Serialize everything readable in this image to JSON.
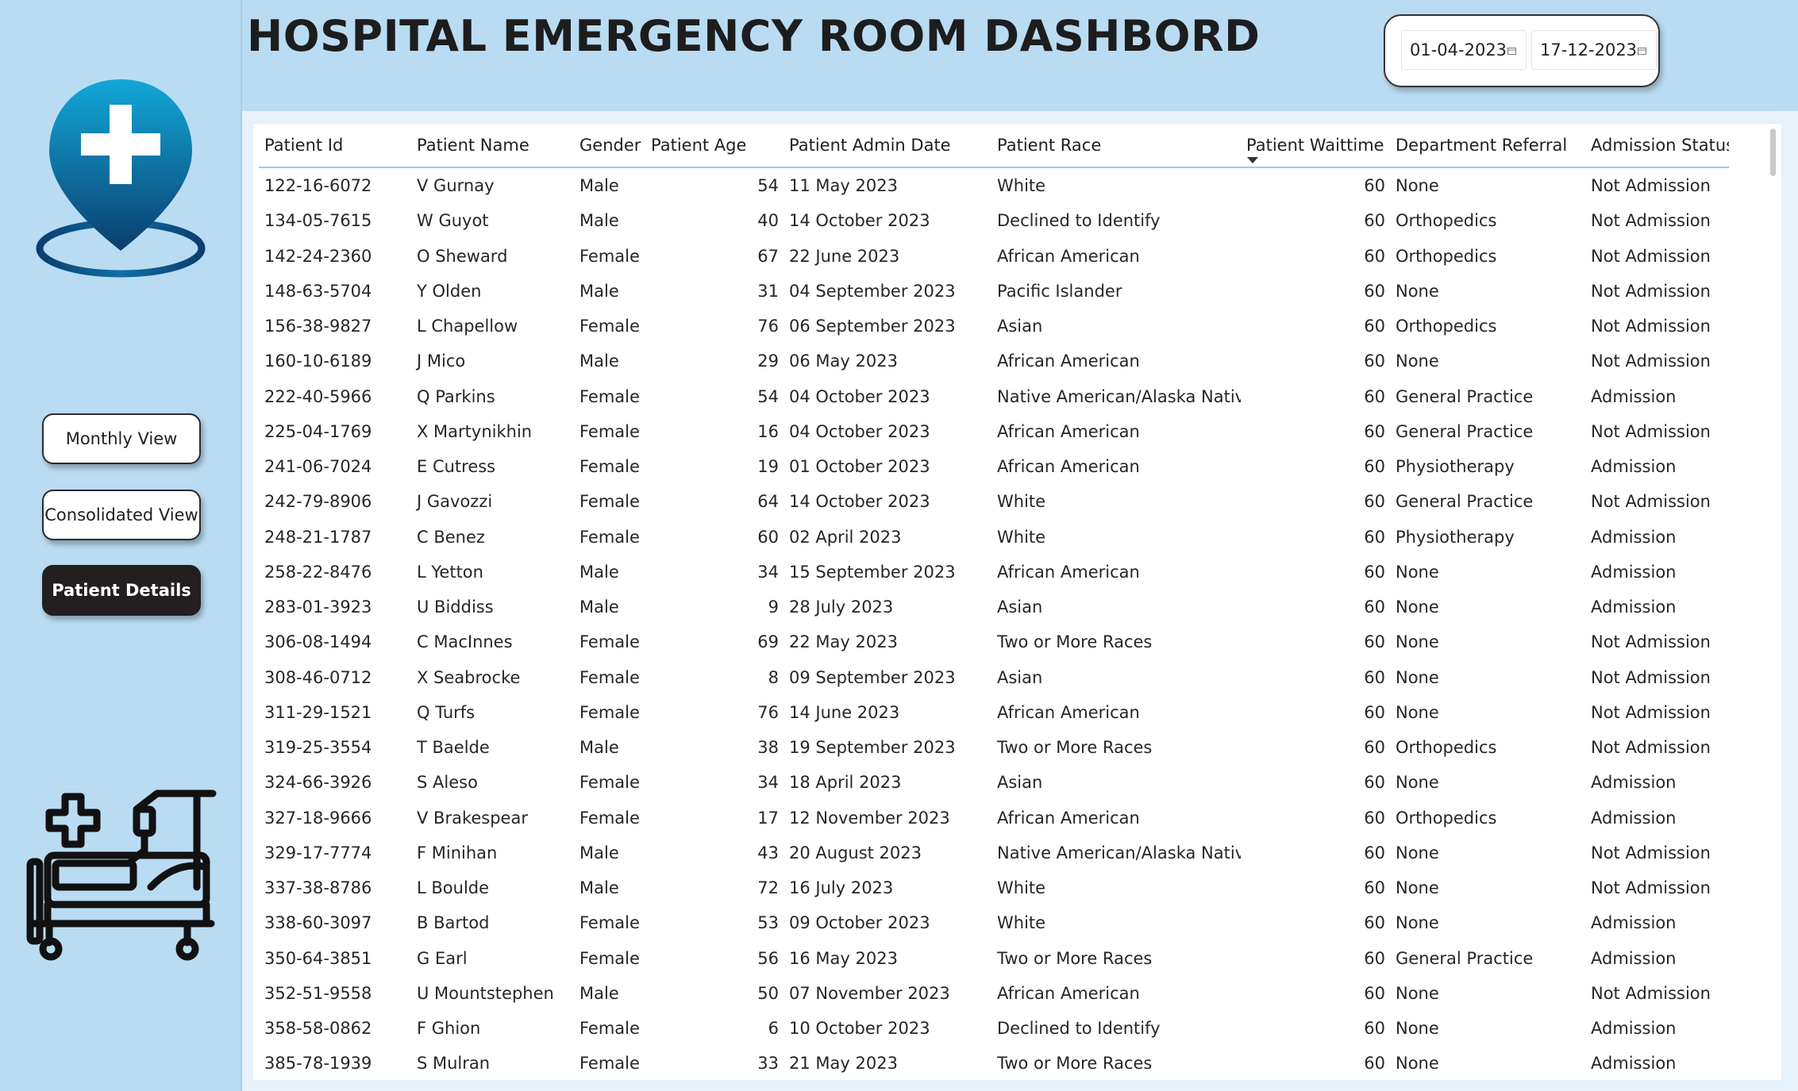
{
  "header": {
    "title": "HOSPITAL EMERGENCY ROOM DASHBORD",
    "date_start": "01-04-2023",
    "date_end": "17-12-2023"
  },
  "nav": {
    "monthly_label": "Monthly View",
    "consolidated_label": "Consolidated View",
    "patient_label": "Patient Details",
    "active": "Patient Details"
  },
  "colors": {
    "background": "#b9dcf3",
    "active_button": "#231f20",
    "pin_gradient_top": "#12a8d8",
    "pin_gradient_bottom": "#0b3e6e"
  },
  "icons": {
    "logo": "location-pin-medical-cross-icon",
    "bed": "hospital-bed-icon",
    "calendar": "calendar-icon",
    "sort": "sort-descending-icon"
  },
  "table": {
    "sorted_column": "Patient Waittime",
    "columns": [
      "Patient Id",
      "Patient Name",
      "Gender",
      "Patient Age",
      "Patient Admin Date",
      "Patient Race",
      "Patient Waittime",
      "Department Referral",
      "Admission Status"
    ],
    "rows": [
      [
        "122-16-6072",
        "V Gurnay",
        "Male",
        "54",
        "11 May 2023",
        "White",
        "60",
        "None",
        "Not Admission"
      ],
      [
        "134-05-7615",
        "W Guyot",
        "Male",
        "40",
        "14 October 2023",
        "Declined to Identify",
        "60",
        "Orthopedics",
        "Not Admission"
      ],
      [
        "142-24-2360",
        "O Sheward",
        "Female",
        "67",
        "22 June 2023",
        "African American",
        "60",
        "Orthopedics",
        "Not Admission"
      ],
      [
        "148-63-5704",
        "Y Olden",
        "Male",
        "31",
        "04 September 2023",
        "Pacific Islander",
        "60",
        "None",
        "Not Admission"
      ],
      [
        "156-38-9827",
        "L Chapellow",
        "Female",
        "76",
        "06 September 2023",
        "Asian",
        "60",
        "Orthopedics",
        "Not Admission"
      ],
      [
        "160-10-6189",
        "J Mico",
        "Male",
        "29",
        "06 May 2023",
        "African American",
        "60",
        "None",
        "Not Admission"
      ],
      [
        "222-40-5966",
        "Q Parkins",
        "Female",
        "54",
        "04 October 2023",
        "Native American/Alaska Native",
        "60",
        "General Practice",
        "Admission"
      ],
      [
        "225-04-1769",
        "X Martynikhin",
        "Female",
        "16",
        "04 October 2023",
        "African American",
        "60",
        "General Practice",
        "Not Admission"
      ],
      [
        "241-06-7024",
        "E Cutress",
        "Female",
        "19",
        "01 October 2023",
        "African American",
        "60",
        "Physiotherapy",
        "Admission"
      ],
      [
        "242-79-8906",
        "J Gavozzi",
        "Female",
        "64",
        "14 October 2023",
        "White",
        "60",
        "General Practice",
        "Not Admission"
      ],
      [
        "248-21-1787",
        "C Benez",
        "Female",
        "60",
        "02 April 2023",
        "White",
        "60",
        "Physiotherapy",
        "Admission"
      ],
      [
        "258-22-8476",
        "L Yetton",
        "Male",
        "34",
        "15 September 2023",
        "African American",
        "60",
        "None",
        "Admission"
      ],
      [
        "283-01-3923",
        "U Biddiss",
        "Male",
        "9",
        "28 July 2023",
        "Asian",
        "60",
        "None",
        "Admission"
      ],
      [
        "306-08-1494",
        "C MacInnes",
        "Female",
        "69",
        "22 May 2023",
        "Two or More Races",
        "60",
        "None",
        "Not Admission"
      ],
      [
        "308-46-0712",
        "X Seabrocke",
        "Female",
        "8",
        "09 September 2023",
        "Asian",
        "60",
        "None",
        "Not Admission"
      ],
      [
        "311-29-1521",
        "Q Turfs",
        "Female",
        "76",
        "14 June 2023",
        "African American",
        "60",
        "None",
        "Not Admission"
      ],
      [
        "319-25-3554",
        "T Baelde",
        "Male",
        "38",
        "19 September 2023",
        "Two or More Races",
        "60",
        "Orthopedics",
        "Not Admission"
      ],
      [
        "324-66-3926",
        "S Aleso",
        "Female",
        "34",
        "18 April 2023",
        "Asian",
        "60",
        "None",
        "Admission"
      ],
      [
        "327-18-9666",
        "V Brakespear",
        "Female",
        "17",
        "12 November 2023",
        "African American",
        "60",
        "Orthopedics",
        "Admission"
      ],
      [
        "329-17-7774",
        "F Minihan",
        "Male",
        "43",
        "20 August 2023",
        "Native American/Alaska Native",
        "60",
        "None",
        "Not Admission"
      ],
      [
        "337-38-8786",
        "L Boulde",
        "Male",
        "72",
        "16 July 2023",
        "White",
        "60",
        "None",
        "Not Admission"
      ],
      [
        "338-60-3097",
        "B Bartod",
        "Female",
        "53",
        "09 October 2023",
        "White",
        "60",
        "None",
        "Admission"
      ],
      [
        "350-64-3851",
        "G Earl",
        "Female",
        "56",
        "16 May 2023",
        "Two or More Races",
        "60",
        "General Practice",
        "Admission"
      ],
      [
        "352-51-9558",
        "U Mountstephen",
        "Male",
        "50",
        "07 November 2023",
        "African American",
        "60",
        "None",
        "Not Admission"
      ],
      [
        "358-58-0862",
        "F Ghion",
        "Female",
        "6",
        "10 October 2023",
        "Declined to Identify",
        "60",
        "None",
        "Admission"
      ],
      [
        "385-78-1939",
        "S Mulran",
        "Female",
        "33",
        "21 May 2023",
        "Two or More Races",
        "60",
        "None",
        "Admission"
      ]
    ]
  }
}
